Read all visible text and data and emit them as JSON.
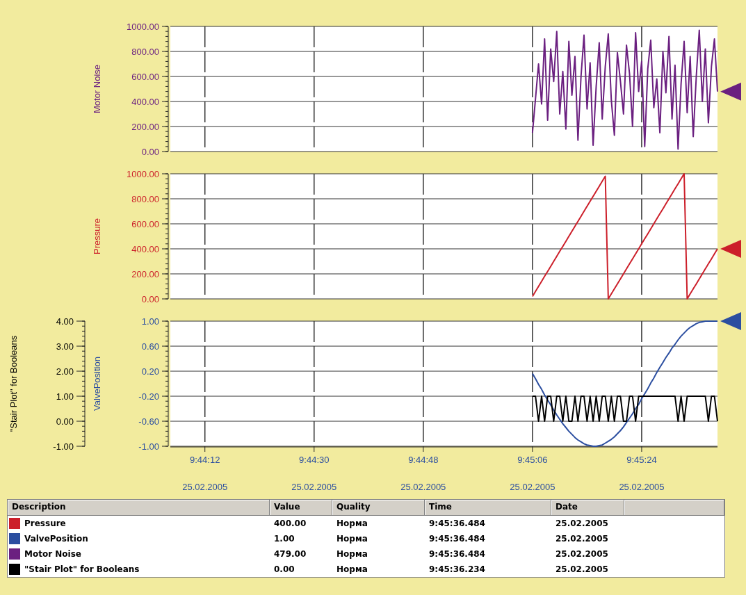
{
  "charts": [
    {
      "chart_data": {
        "type": "line",
        "grid": true,
        "ylim": [
          0,
          1000
        ],
        "yticks": [
          {
            "value": 0,
            "label": "0.00"
          },
          {
            "value": 200,
            "label": "200.00"
          },
          {
            "value": 400,
            "label": "400.00"
          },
          {
            "value": 600,
            "label": "600.00"
          },
          {
            "value": 800,
            "label": "800.00"
          },
          {
            "value": 1000,
            "label": "1000.00"
          }
        ],
        "xlim": [
          35046.3,
          35136.5
        ],
        "x": [
          35106,
          35106.5,
          35107,
          35107.5,
          35108,
          35108.5,
          35109,
          35109.5,
          35110,
          35110.5,
          35111,
          35111.5,
          35112,
          35112.5,
          35113,
          35113.5,
          35114,
          35114.5,
          35115,
          35115.5,
          35116,
          35116.5,
          35117,
          35117.5,
          35118,
          35118.5,
          35119,
          35119.5,
          35120,
          35120.5,
          35121,
          35121.5,
          35122,
          35122.5,
          35123,
          35123.5,
          35124,
          35124.5,
          35125,
          35125.5,
          35126,
          35126.5,
          35127,
          35127.5,
          35128,
          35128.5,
          35129,
          35129.5,
          35130,
          35130.5,
          35131,
          35131.5,
          35132,
          35132.5,
          35133,
          35133.5,
          35134,
          35134.5,
          35135,
          35135.5,
          35136,
          35136.5
        ],
        "series": [
          {
            "name": "Motor Noise",
            "color": "#6b2080",
            "marker": true,
            "values": [
              150,
              420,
              700,
              380,
              900,
              250,
              820,
              560,
              960,
              300,
              640,
              180,
              880,
              450,
              760,
              90,
              600,
              930,
              340,
              710,
              50,
              520,
              870,
              260,
              680,
              940,
              410,
              130,
              790,
              560,
              300,
              850,
              620,
              200,
              950,
              480,
              720,
              40,
              660,
              890,
              350,
              580,
              150,
              800,
              470,
              920,
              260,
              690,
              20,
              540,
              880,
              310,
              760,
              120,
              600,
              970,
              400,
              820,
              230,
              680,
              900,
              479
            ]
          }
        ]
      }
    },
    {
      "chart_data": {
        "type": "line",
        "grid": true,
        "ylim": [
          0,
          1000
        ],
        "yticks": [
          {
            "value": 0,
            "label": "0.00"
          },
          {
            "value": 200,
            "label": "200.00"
          },
          {
            "value": 400,
            "label": "400.00"
          },
          {
            "value": 600,
            "label": "600.00"
          },
          {
            "value": 800,
            "label": "800.00"
          },
          {
            "value": 1000,
            "label": "1000.00"
          }
        ],
        "xlim": [
          35046.3,
          35136.5
        ],
        "x": [
          35106,
          35106.5,
          35107,
          35107.5,
          35108,
          35108.5,
          35109,
          35109.5,
          35110,
          35110.5,
          35111,
          35111.5,
          35112,
          35112.5,
          35113,
          35113.5,
          35114,
          35114.5,
          35115,
          35115.5,
          35116,
          35116.5,
          35117,
          35117.5,
          35118,
          35118.5,
          35119,
          35119.5,
          35120,
          35120.5,
          35121,
          35121.5,
          35122,
          35122.5,
          35123,
          35123.5,
          35124,
          35124.5,
          35125,
          35125.5,
          35126,
          35126.5,
          35127,
          35127.5,
          35128,
          35128.5,
          35129,
          35129.5,
          35130,
          35130.5,
          35131,
          35131.5,
          35132,
          35132.5,
          35133,
          35133.5,
          35134,
          35134.5,
          35135,
          35135.5,
          35136,
          35136.5
        ],
        "series": [
          {
            "name": "Pressure",
            "color": "#cc1f2a",
            "marker": true,
            "values": [
              20,
              60,
              100,
              140,
              180,
              220,
              260,
              300,
              340,
              380,
              420,
              460,
              500,
              540,
              580,
              620,
              660,
              700,
              740,
              780,
              820,
              860,
              900,
              940,
              980,
              0,
              40,
              80,
              120,
              160,
              200,
              240,
              280,
              320,
              360,
              400,
              440,
              480,
              520,
              560,
              600,
              640,
              680,
              720,
              760,
              800,
              840,
              880,
              920,
              960,
              1000,
              0,
              40,
              80,
              120,
              160,
              200,
              240,
              280,
              320,
              360,
              400
            ]
          }
        ]
      }
    },
    {
      "tick_dates": [
        "25.02.2005",
        "25.02.2005",
        "25.02.2005",
        "25.02.2005",
        "25.02.2005"
      ],
      "chart_data": {
        "type": "line",
        "grid": true,
        "ylim": [
          -1,
          1
        ],
        "yticks": [
          {
            "value": -1,
            "label": "-1.00"
          },
          {
            "value": -0.6,
            "label": "-0.60"
          },
          {
            "value": -0.2,
            "label": "-0.20"
          },
          {
            "value": 0.2,
            "label": "0.20"
          },
          {
            "value": 0.6,
            "label": "0.60"
          },
          {
            "value": 1,
            "label": "1.00"
          }
        ],
        "y2lim": [
          -1,
          4
        ],
        "y2ticks": [
          {
            "value": -1,
            "label": "-1.00"
          },
          {
            "value": 0,
            "label": "0.00"
          },
          {
            "value": 1,
            "label": "1.00"
          },
          {
            "value": 2,
            "label": "2.00"
          },
          {
            "value": 3,
            "label": "3.00"
          },
          {
            "value": 4,
            "label": "4.00"
          }
        ],
        "xlim": [
          35046.3,
          35136.5
        ],
        "xticks": [
          {
            "value": 35052,
            "label": "9:44:12"
          },
          {
            "value": 35070,
            "label": "9:44:30"
          },
          {
            "value": 35088,
            "label": "9:44:48"
          },
          {
            "value": 35106,
            "label": "9:45:06"
          },
          {
            "value": 35124,
            "label": "9:45:24"
          }
        ],
        "x": [
          35106,
          35106.5,
          35107,
          35107.5,
          35108,
          35108.5,
          35109,
          35109.5,
          35110,
          35110.5,
          35111,
          35111.5,
          35112,
          35112.5,
          35113,
          35113.5,
          35114,
          35114.5,
          35115,
          35115.5,
          35116,
          35116.5,
          35117,
          35117.5,
          35118,
          35118.5,
          35119,
          35119.5,
          35120,
          35120.5,
          35121,
          35121.5,
          35122,
          35122.5,
          35123,
          35123.5,
          35124,
          35124.5,
          35125,
          35125.5,
          35126,
          35126.5,
          35127,
          35127.5,
          35128,
          35128.5,
          35129,
          35129.5,
          35130,
          35130.5,
          35131,
          35131.5,
          35132,
          35132.5,
          35133,
          35133.5,
          35134,
          35134.5,
          35135,
          35135.5,
          35136,
          35136.5
        ],
        "series": [
          {
            "name": "ValvePosition",
            "color": "#2b4ea0",
            "marker": true,
            "axis": "y",
            "values": [
              0.16,
              0.08,
              -0.01,
              -0.09,
              -0.18,
              -0.26,
              -0.34,
              -0.42,
              -0.5,
              -0.57,
              -0.64,
              -0.7,
              -0.76,
              -0.81,
              -0.86,
              -0.9,
              -0.93,
              -0.96,
              -0.98,
              -0.99,
              -1,
              -1,
              -0.99,
              -0.98,
              -0.95,
              -0.92,
              -0.89,
              -0.85,
              -0.8,
              -0.75,
              -0.69,
              -0.62,
              -0.55,
              -0.48,
              -0.4,
              -0.33,
              -0.24,
              -0.16,
              -0.08,
              0.01,
              0.09,
              0.18,
              0.26,
              0.34,
              0.42,
              0.49,
              0.57,
              0.63,
              0.7,
              0.76,
              0.81,
              0.86,
              0.9,
              0.93,
              0.96,
              0.98,
              0.99,
              1,
              1,
              1,
              1,
              1
            ]
          },
          {
            "name": "\"Stair Plot\" for Booleans",
            "color": "#000000",
            "marker": false,
            "axis": "y2",
            "values": [
              1,
              1,
              0,
              1,
              0,
              1,
              1,
              0,
              1,
              1,
              0,
              1,
              0,
              0,
              1,
              0,
              1,
              1,
              0,
              1,
              0,
              1,
              0,
              1,
              1,
              0,
              1,
              0,
              1,
              1,
              0,
              0,
              1,
              1,
              0,
              1,
              1,
              1,
              1,
              1,
              1,
              1,
              1,
              1,
              1,
              1,
              1,
              1,
              0,
              1,
              0,
              1,
              1,
              1,
              1,
              1,
              1,
              1,
              0,
              1,
              1,
              0
            ]
          }
        ]
      }
    }
  ],
  "table": {
    "columns": [
      "Description",
      "Value",
      "Quality",
      "Time",
      "Date"
    ],
    "rows": [
      {
        "color": "#cc1f2a",
        "description": "Pressure",
        "value": "400.00",
        "quality": "Норма",
        "time": "9:45:36.484",
        "date": "25.02.2005"
      },
      {
        "color": "#2b4ea0",
        "description": "ValvePosition",
        "value": "1.00",
        "quality": "Норма",
        "time": "9:45:36.484",
        "date": "25.02.2005"
      },
      {
        "color": "#6b2080",
        "description": "Motor Noise",
        "value": "479.00",
        "quality": "Норма",
        "time": "9:45:36.484",
        "date": "25.02.2005"
      },
      {
        "color": "#000000",
        "description": "\"Stair Plot\" for Booleans",
        "value": "0.00",
        "quality": "Норма",
        "time": "9:45:36.234",
        "date": "25.02.2005"
      }
    ]
  }
}
